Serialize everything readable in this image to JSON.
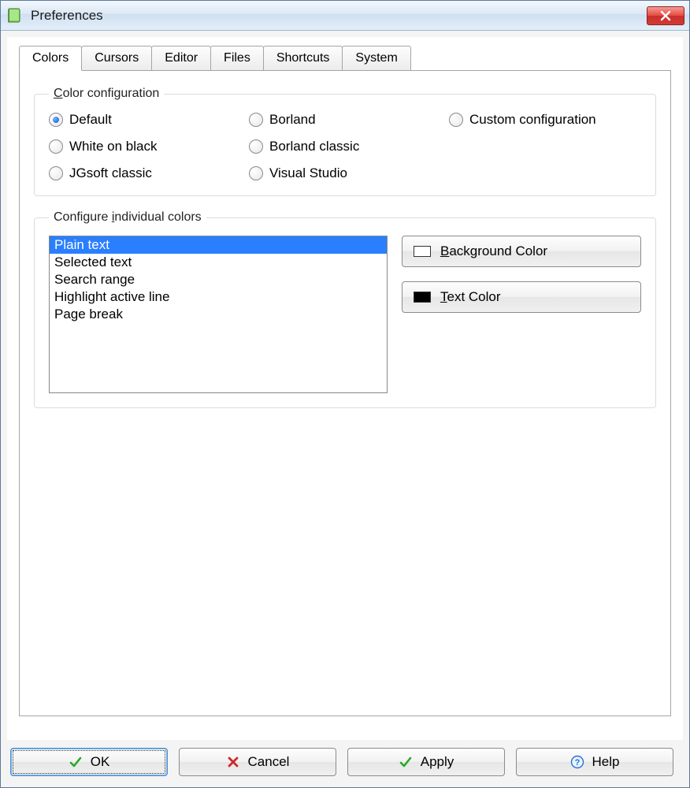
{
  "window": {
    "title": "Preferences",
    "icon": "book-icon"
  },
  "tabs": [
    {
      "label": "Colors",
      "active": true
    },
    {
      "label": "Cursors",
      "active": false
    },
    {
      "label": "Editor",
      "active": false
    },
    {
      "label": "Files",
      "active": false
    },
    {
      "label": "Shortcuts",
      "active": false
    },
    {
      "label": "System",
      "active": false
    }
  ],
  "color_config": {
    "legend_prefix": "C",
    "legend_rest": "olor configuration",
    "options": [
      {
        "label": "Default",
        "selected": true
      },
      {
        "label": "Borland",
        "selected": false
      },
      {
        "label": "Custom configuration",
        "selected": false
      },
      {
        "label": "White on black",
        "selected": false
      },
      {
        "label": "Borland classic",
        "selected": false
      },
      {
        "label": "JGsoft classic",
        "selected": false
      },
      {
        "label": "Visual Studio",
        "selected": false
      }
    ]
  },
  "individual": {
    "legend_a": "Configure ",
    "legend_u": "i",
    "legend_b": "ndividual colors",
    "items": [
      {
        "label": "Plain text",
        "selected": true
      },
      {
        "label": "Selected text",
        "selected": false
      },
      {
        "label": "Search range",
        "selected": false
      },
      {
        "label": "Highlight active line",
        "selected": false
      },
      {
        "label": "Page break",
        "selected": false
      }
    ],
    "bg_button": {
      "prefix": "B",
      "rest": "ackground Color",
      "swatch": "#ffffff"
    },
    "text_button": {
      "prefix": "T",
      "rest": "ext Color",
      "swatch": "#000000"
    }
  },
  "footer": {
    "ok": "OK",
    "cancel": "Cancel",
    "apply": "Apply",
    "help": "Help"
  }
}
